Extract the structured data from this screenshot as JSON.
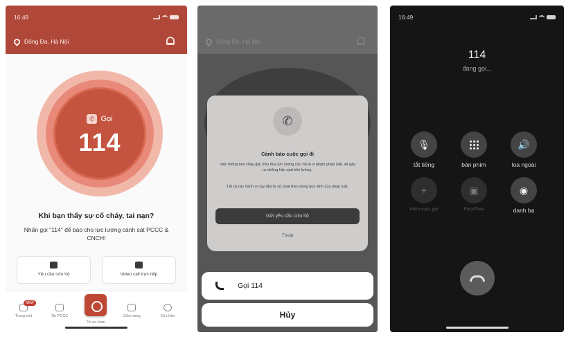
{
  "screen1": {
    "time": "16:49",
    "location": "Đống Đa, Hà Nội",
    "call_button": {
      "label": "Gọi",
      "number": "114"
    },
    "prompt_title": "Khi bạn thấy sự cố cháy, tai nạn?",
    "prompt_subtitle": "Nhấn gọi \"114\" để báo cho lực lượng cảnh sát PCCC & CNCH!",
    "cards": [
      {
        "label": "Yêu cầu cứu hộ",
        "icon": "rescue-icon"
      },
      {
        "label": "Video call trực tiếp",
        "icon": "video-call-icon"
      }
    ],
    "tabs": [
      {
        "label": "Trang chủ",
        "icon": "home-icon",
        "badge": "NEW"
      },
      {
        "label": "Tin PCCC",
        "icon": "news-icon"
      },
      {
        "label": "Tin an toàn",
        "icon": "shield-icon"
      },
      {
        "label": "Cẩm nang",
        "icon": "tools-icon"
      },
      {
        "label": "Cá nhân",
        "icon": "profile-icon"
      }
    ]
  },
  "screen2": {
    "location": "Đống Đa, Hà Nội",
    "dialog": {
      "icon": "outgoing-call-icon",
      "title": "Cảnh báo cuộc gọi đi",
      "paragraph1": "Việc thông báo cháy giả, trêu đùa lực lượng cứu hộ là vi phạm pháp luật, sẽ gây ra những hậu quả khó lường.",
      "paragraph2": "Tất cả các hành vi này đều bị xử phạt theo đúng quy định của pháp luật.",
      "confirm_button": "Gửi yêu cầu cứu hộ",
      "close_button": "Thoát"
    },
    "sheet": {
      "call_option": "Gọi 114",
      "cancel": "Hủy"
    }
  },
  "screen3": {
    "time": "16:49",
    "number": "114",
    "status": "đang gọi...",
    "controls": [
      {
        "label": "tắt tiếng",
        "icon": "mute-icon",
        "enabled": true
      },
      {
        "label": "bàn phím",
        "icon": "keypad-icon",
        "enabled": true
      },
      {
        "label": "loa ngoài",
        "icon": "speaker-icon",
        "enabled": true
      },
      {
        "label": "thêm cuộc gọi",
        "icon": "add-call-icon",
        "enabled": false
      },
      {
        "label": "FaceTime",
        "icon": "facetime-icon",
        "enabled": false
      },
      {
        "label": "danh bạ",
        "icon": "contacts-icon",
        "enabled": true
      }
    ]
  }
}
